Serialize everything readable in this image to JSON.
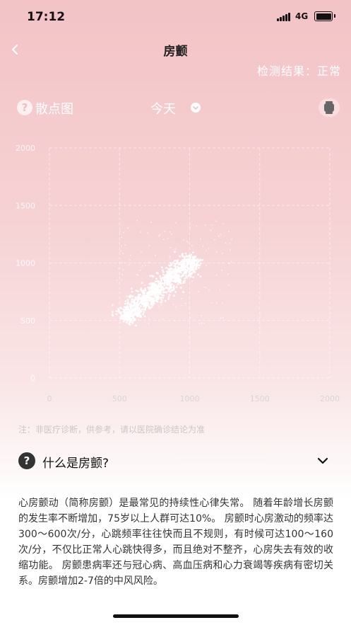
{
  "status_bar": {
    "time": "17:12",
    "network": "4G"
  },
  "header": {
    "title": "房颤",
    "result": "检测结果：正常"
  },
  "controls": {
    "help_symbol": "?",
    "chart_type_label": "散点图",
    "date_label": "今天"
  },
  "chart_data": {
    "type": "scatter",
    "title": "",
    "xlabel": "",
    "ylabel": "",
    "xlim": [
      0,
      2000
    ],
    "ylim": [
      0,
      2000
    ],
    "x_ticks": [
      "0",
      "500",
      "1000",
      "1500",
      "2000"
    ],
    "y_ticks": [
      "0",
      "500",
      "1000",
      "1500",
      "2000"
    ],
    "grid": true,
    "color": "#ffffff",
    "series": [
      {
        "values": "dense elongated cluster along the diagonal, x and y roughly 500 to 1050, centered near (780, 780), plus sparse outliers between 500 and 1300"
      }
    ]
  },
  "disclaimer": "注：非医疗诊断，供参考，请以医院确诊结论为准",
  "faq": {
    "icon_symbol": "?",
    "title": "什么是房颤?",
    "body": "心房颤动（简称房颤）是最常见的持续性心律失常。 随着年龄增长房颤的发生率不断增加，75岁以上人群可达10%。 房颤时心房激动的频率达300～600次/分，心跳频率往往快而且不规则，有时候可达100～160次/分，不仅比正常人心跳快得多，而且绝对不整齐，心房失去有效的收缩功能。 房颤患病率还与冠心病、高血压病和心力衰竭等疾病有密切关系。房颤增加2-7倍的中风风险。"
  }
}
